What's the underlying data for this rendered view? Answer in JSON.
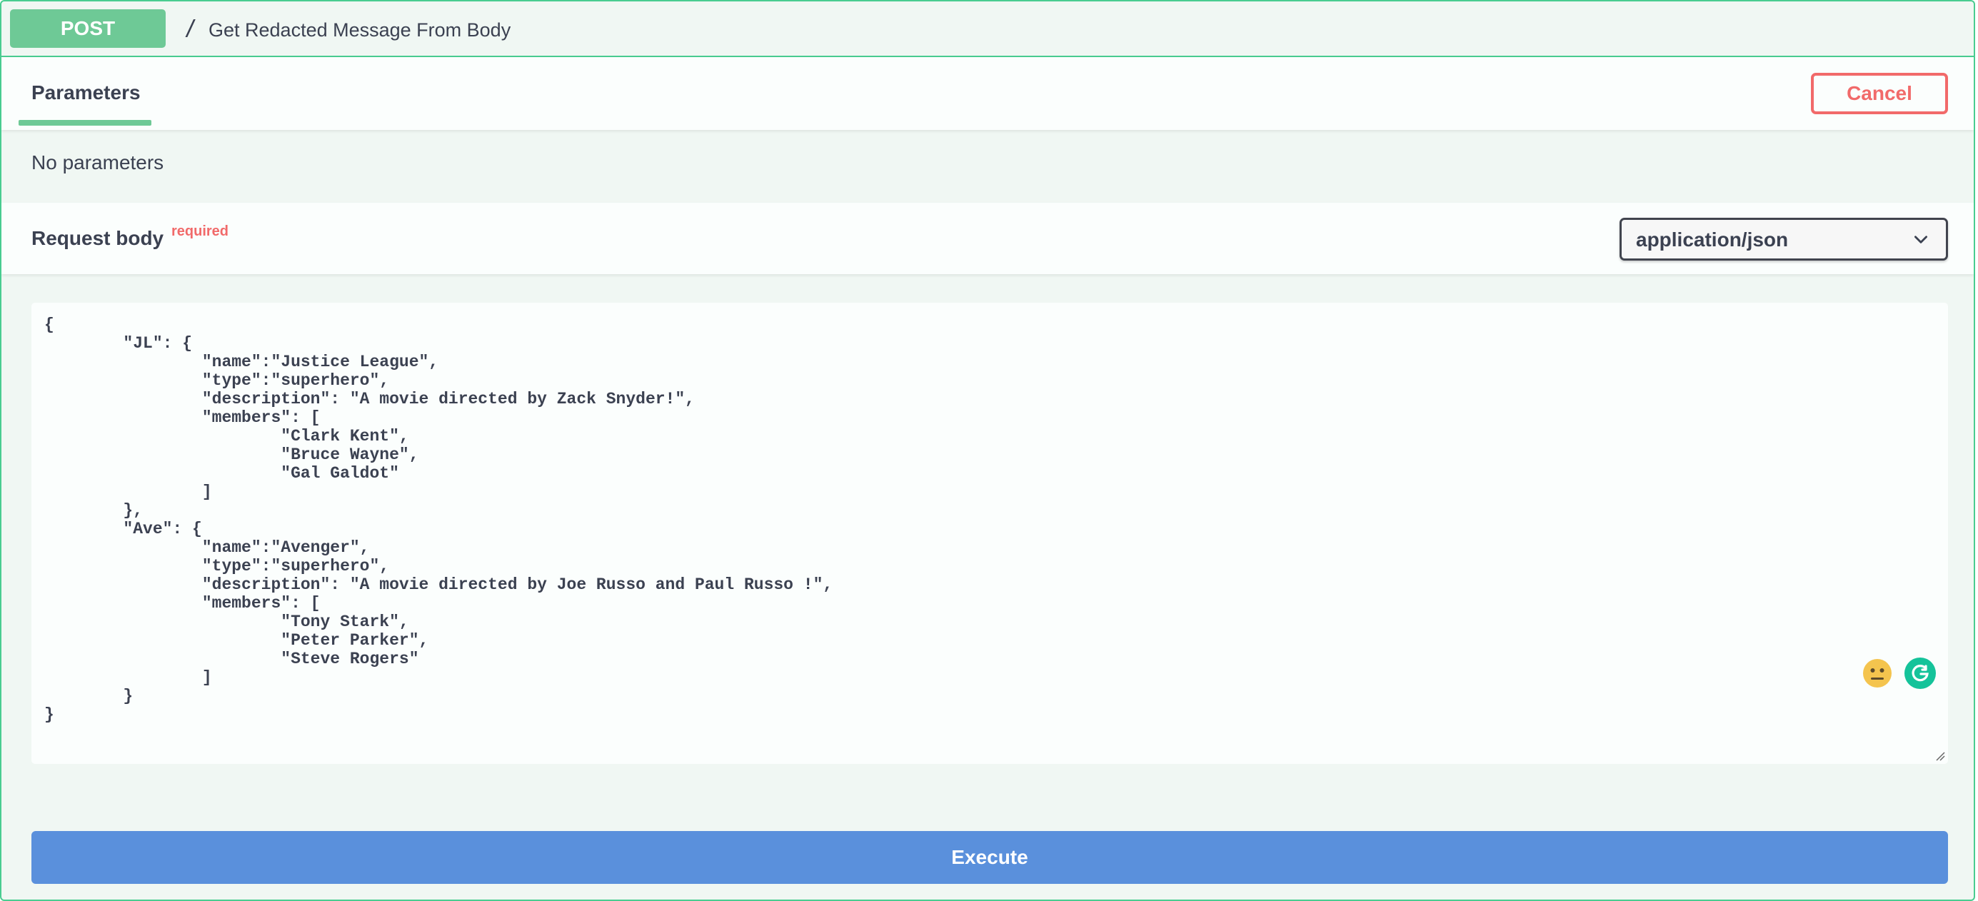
{
  "operation": {
    "method": "POST",
    "path": "/",
    "summary": "Get Redacted Message From Body"
  },
  "parameters_tab": {
    "label": "Parameters",
    "cancel_label": "Cancel",
    "empty_text": "No parameters"
  },
  "request_body": {
    "label": "Request body",
    "required_label": "required",
    "content_type": "application/json",
    "example": "{\n\t\"JL\": {\n\t\t\"name\":\"Justice League\",\n\t\t\"type\":\"superhero\",\n\t\t\"description\": \"A movie directed by Zack Snyder!\",\n\t\t\"members\": [\n\t\t\t\"Clark Kent\",\n\t\t\t\"Bruce Wayne\",\n\t\t\t\"Gal Galdot\"\n\t\t]\n\t},\n\t\"Ave\": {\n\t\t\"name\":\"Avenger\",\n\t\t\"type\":\"superhero\",\n\t\t\"description\": \"A movie directed by Joe Russo and Paul Russo !\",\n\t\t\"members\": [\n\t\t\t\"Tony Stark\",\n\t\t\t\"Peter Parker\",\n\t\t\t\"Steve Rogers\"\n\t\t]\n\t}\n}"
  },
  "execute": {
    "label": "Execute"
  },
  "icons": {
    "emoji": "neutral-face-icon",
    "grammarly": "grammarly-icon",
    "dropdown": "chevron-down-icon"
  },
  "colors": {
    "post_green": "#49cc90",
    "method_badge": "#6ec996",
    "cancel_red": "#f16a6a",
    "execute_blue": "#5a90dc"
  }
}
